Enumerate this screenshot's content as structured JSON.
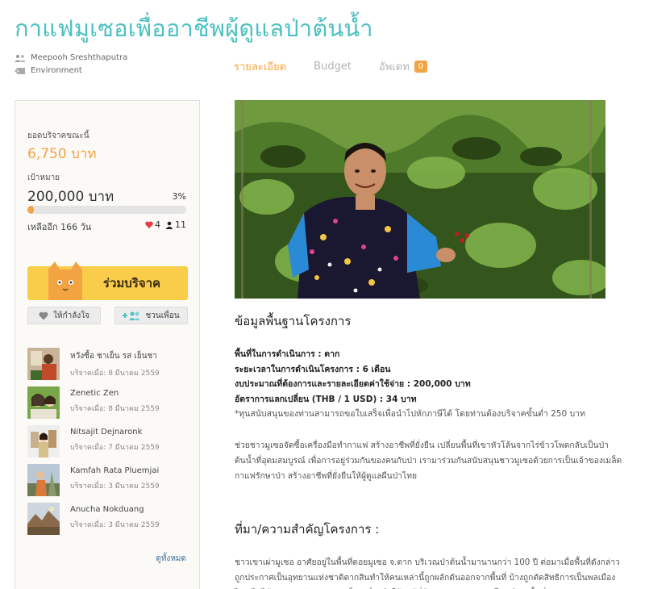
{
  "page": {
    "title": "กาแฟมูเซอเพื่ออาชีพผู้ดูแลป่าต้นน้ำ"
  },
  "meta": {
    "author": "Meepooh Sreshthaputra",
    "category": "Environment",
    "author_icon": "people-icon",
    "category_icon": "tag-icon"
  },
  "tabs": [
    {
      "label": "รายละเอียด",
      "active": true
    },
    {
      "label": "Budget",
      "active": false
    },
    {
      "label": "อัพเดท",
      "active": false,
      "badge": "0"
    }
  ],
  "funding": {
    "raised_label": "ยอดบริจาคขณะนี้",
    "raised_value": "6,750 บาท",
    "goal_label": "เป้าหมาย",
    "goal_value": "200,000 บาท",
    "percent_label": "3%",
    "percent": 3,
    "days_left": "เหลืออีก 166 วัน",
    "likes": "4",
    "backers": "11",
    "accent_color": "#f2a443"
  },
  "actions": {
    "donate_label": "ร่วมบริจาค",
    "encourage_label": "ให้กำลังใจ",
    "invite_label": "ชวนเพื่อน"
  },
  "donors": [
    {
      "name": "หวังซื้อ ชาเย็น รส เย็นชา",
      "when": "บริจาคเมื่อ: 8 มีนาคม 2559"
    },
    {
      "name": "Zenetic Zen",
      "when": "บริจาคเมื่อ: 8 มีนาคม 2559"
    },
    {
      "name": "Nitsajit Dejnaronk",
      "when": "บริจาคเมื่อ: 7 มีนาคม 2559"
    },
    {
      "name": "Kamfah Rata Pluemjai",
      "when": "บริจาคเมื่อ: 3 มีนาคม 2559"
    },
    {
      "name": "Anucha Nokduang",
      "when": "บริจาคเมื่อ: 3 มีนาคม 2559"
    }
  ],
  "see_all": "ดูทั้งหมด",
  "section1": {
    "title": "ข้อมูลพื้นฐานโครงการ",
    "area": "พื้นที่ในการดำเนินการ : ตาก",
    "duration": "ระยะเวลาในการดำเนินโครงการ : 6 เดือน",
    "budget": "งบประมาณที่ต้องการและรายละเอียดค่าใช้จ่าย : 200,000 บาท",
    "rate": "อัตราการแลกเปลี่ยน (THB / 1 USD) : 34 บาท",
    "note": "*ทุนสนับสนุนของท่านสามารถขอใบเสร็จเพื่อนำไปหักภาษีได้ โดยท่านต้องบริจาคขั้นต่ำ 250 บาท",
    "paragraph": "ช่วยชาวมูเซอจัดซื้อเครื่องมือทำกาแฟ สร้างอาชีพที่ยั่งยืน เปลี่ยนพื้นที่เขาหัวโล้นจากไร่ข้าวโพดกลับเป็นป่าต้นน้ำที่อุดมสมบูรณ์ เพื่อการอยู่ร่วมกันของคนกับป่า  เรามาร่วมกันสนับสนุนชาวมูเซอด้วยการเป็นเจ้าของเมล็ดกาแฟรักษาป่า สร้างอาชีพที่ยั่งยืนให้ผู้ดูแลผืนป่าไทย"
  },
  "section2": {
    "title": "ที่มา/ความสำคัญโครงการ :",
    "paragraph": "ชาวเขาเผ่ามูเซอ   อาศัยอยู่ในพื้นที่ดอยมูเซอ จ.ตาก บริเวณป่าต้นน้ำมานานกว่า 100 ปี ต่อมาเมื่อพื้นที่ดังกล่าวถูกประกาศเป็นอุทยานแห่งชาติตากสินทำให้คนเหล่านี้ถูกผลักดันออกจากพื้นที่ บ้างถูกตัดสิทธิการเป็นพลเมืองไทย ไม่ได้รับสัญชาติ และกลายเป็นเครื่องมือให้แก่ผู้ที่ต้องการแสวงหาประโยชน์จากพื้นที่ป่า"
  }
}
